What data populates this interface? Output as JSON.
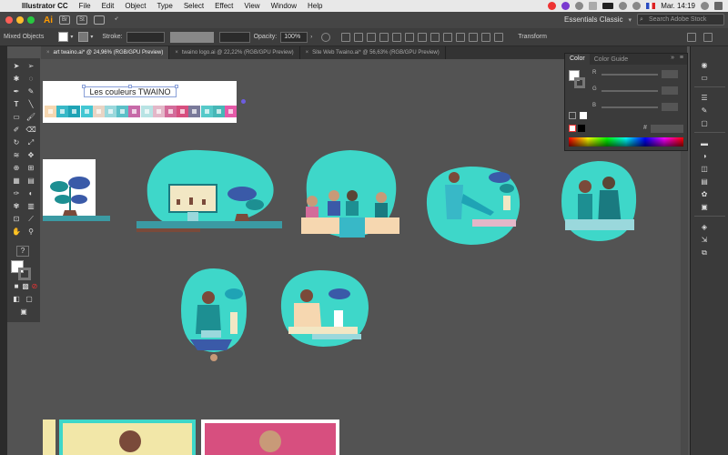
{
  "menubar": {
    "apple": "",
    "items": [
      "Illustrator CC",
      "File",
      "Edit",
      "Object",
      "Type",
      "Select",
      "Effect",
      "View",
      "Window",
      "Help"
    ],
    "clock": "Mar. 14:19"
  },
  "appbar": {
    "logo": "Ai",
    "workspace": "Essentials Classic",
    "search_placeholder": "Search Adobe Stock"
  },
  "control_bar": {
    "selection": "Mixed Objects",
    "stroke_label": "Stroke:",
    "opacity_label": "Opacity:",
    "opacity_value": "100%",
    "transform_label": "Transform"
  },
  "tabs": [
    {
      "label": "art twaino.ai* @ 24,96% (RGB/GPU Preview)",
      "active": true
    },
    {
      "label": "twaino logo.ai @ 22,22% (RGB/GPU Preview)",
      "active": false
    },
    {
      "label": "Site Web Twaino.ai* @ 56,63% (RGB/GPU Preview)",
      "active": false
    }
  ],
  "color_panel": {
    "tabs": [
      "Color",
      "Color Guide"
    ],
    "channels": [
      "R",
      "G",
      "B"
    ],
    "hex_prefix": "#"
  },
  "artboard": {
    "title": "Les couleurs TWAINO",
    "palette": [
      "#f6d7b0",
      "#38b8c7",
      "#1fa3b5",
      "#43c7d3",
      "#e9d4c4",
      "#9ad8dc",
      "#5cc0c8",
      "#c76aa8",
      "#b8e3e4",
      "#e3b7c8",
      "#d36b9a",
      "#d74f7f",
      "#7a7a9a",
      "#56c9c9",
      "#46b7b7",
      "#e55aa8"
    ]
  },
  "colors": {
    "mint": "#3ed7c9",
    "dark_teal": "#1a7a80",
    "plant": "#1d8f92",
    "blue_leaf": "#3a5aa8",
    "pot": "#7a4a3a",
    "floor": "#3b9aa3"
  }
}
